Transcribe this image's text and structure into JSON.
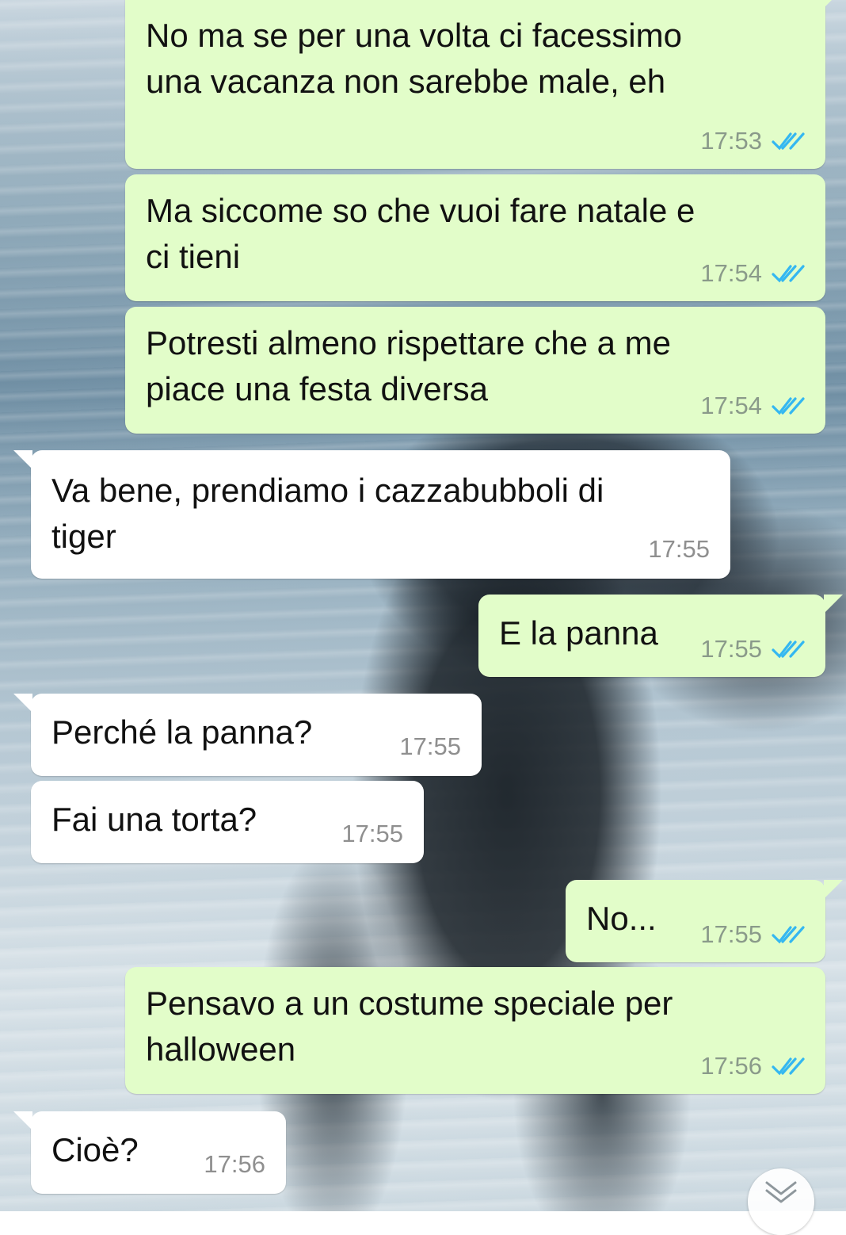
{
  "messages": [
    {
      "direction": "out",
      "text": "No ma se per una volta ci facessimo\nuna vacanza non sarebbe male, eh",
      "time": "17:53",
      "status": "read"
    },
    {
      "direction": "out",
      "text": "Ma siccome so che vuoi fare natale e\nci tieni",
      "time": "17:54",
      "status": "read"
    },
    {
      "direction": "out",
      "text": "Potresti almeno rispettare che a me\npiace una festa diversa",
      "time": "17:54",
      "status": "read"
    },
    {
      "direction": "in",
      "text": "Va bene, prendiamo i cazzabubboli di\ntiger",
      "time": "17:55"
    },
    {
      "direction": "out",
      "text": "E la panna",
      "time": "17:55",
      "status": "read"
    },
    {
      "direction": "in",
      "text": "Perché la panna?",
      "time": "17:55"
    },
    {
      "direction": "in",
      "text": "Fai una torta?",
      "time": "17:55"
    },
    {
      "direction": "out",
      "text": "No...",
      "time": "17:55",
      "status": "read"
    },
    {
      "direction": "out",
      "text": "Pensavo a un costume speciale per\nhalloween",
      "time": "17:56",
      "status": "read"
    },
    {
      "direction": "in",
      "text": "Cioè?",
      "time": "17:56"
    }
  ],
  "colors": {
    "outgoing_bubble": "#e2fdc9",
    "incoming_bubble": "#ffffff",
    "read_ticks": "#34b7f1"
  },
  "icons": {
    "read_receipt": "double-check-icon",
    "scroll_down": "chevron-double-down-icon"
  }
}
